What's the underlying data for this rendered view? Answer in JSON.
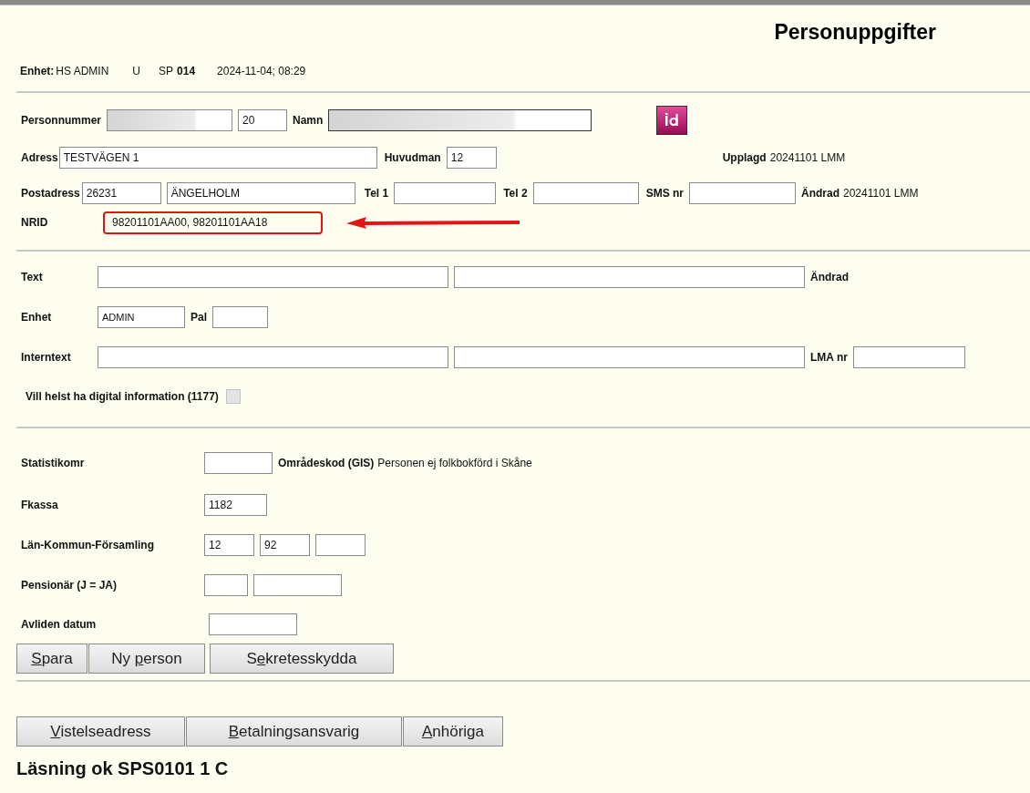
{
  "title": "Personuppgifter",
  "header": {
    "unit_label": "Enhet:",
    "unit_value": "HS ADMIN",
    "mode": "U",
    "sp_label": "SP",
    "sp_value": "014",
    "datetime": "2024-11-04; 08:29"
  },
  "person": {
    "personnummer_label": "Personnummer",
    "century": "20",
    "name_label": "Namn",
    "address_label": "Adress",
    "address": "TESTVÄGEN 1",
    "principal_label": "Huvudman",
    "principal": "12",
    "created_label": "Upplagd",
    "created_value": "20241101 LMM",
    "postal_label": "Postadress",
    "postal_code": "26231",
    "city": "ÄNGELHOLM",
    "tel1_label": "Tel 1",
    "tel2_label": "Tel 2",
    "sms_label": "SMS nr",
    "changed_label": "Ändrad",
    "changed_value": "20241101 LMM",
    "nrid_label": "NRID",
    "nrid": "98201101AA00, 98201101AA18"
  },
  "notes": {
    "text_label": "Text",
    "changed_label": "Ändrad",
    "unit_label": "Enhet",
    "unit": "ADMIN",
    "pal_label": "Pal",
    "internal_label": "Interntext",
    "lma_label": "LMA nr",
    "digital_label": "Vill helst ha digital information (1177)",
    "digital_checked": false
  },
  "stats": {
    "area_label": "Statistikomr",
    "gis_label": "Områdeskod (GIS)",
    "gis_value": "Personen ej folkbokförd i Skåne",
    "fkassa_label": "Fkassa",
    "fkassa": "1182",
    "county_label": "Län-Kommun-Församling",
    "county": "12",
    "municipality": "92",
    "pension_label": "Pensionär (J = JA)",
    "deceased_label": "Avliden datum"
  },
  "actions": [
    {
      "access_key": "S",
      "label_after": "para"
    },
    {
      "label_before": "Ny ",
      "access_key": "p",
      "label_after": "erson"
    },
    {
      "label_before": "S",
      "access_key": "e",
      "label_after": "kretesskydda"
    }
  ],
  "links": [
    {
      "access_key": "V",
      "label_after": "istelseadress"
    },
    {
      "access_key": "B",
      "label_after": "etalningsansvarig"
    },
    {
      "access_key": "A",
      "label_after": "nhöriga"
    }
  ],
  "status": "Läsning ok SPS0101 1 C"
}
